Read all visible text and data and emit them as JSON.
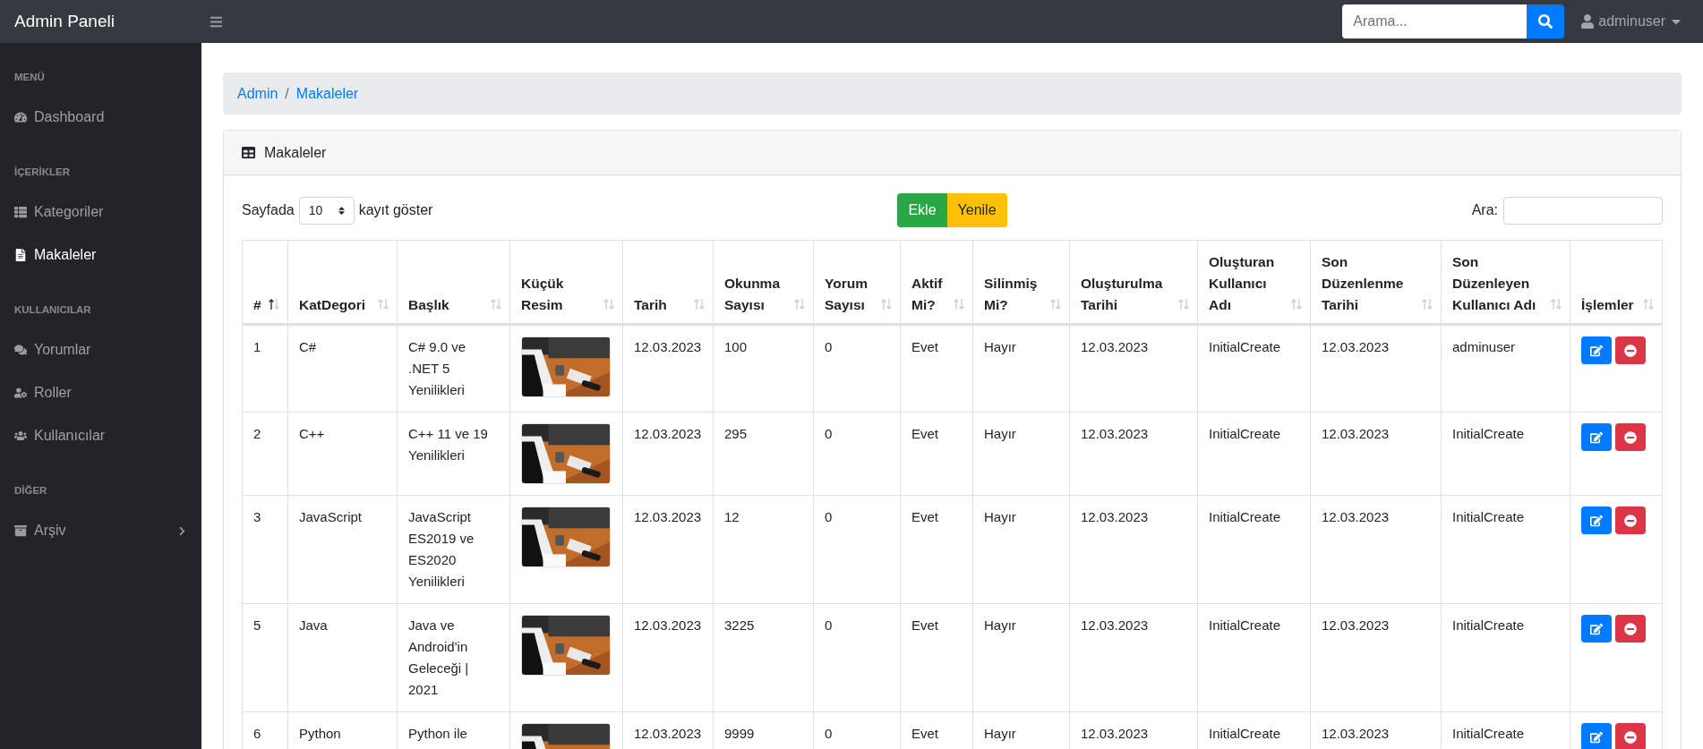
{
  "topbar": {
    "brand": "Admin Paneli",
    "search": {
      "placeholder": "Arama..."
    },
    "user": "adminuser"
  },
  "sidebar": {
    "sections": [
      {
        "heading": "MENÜ",
        "items": [
          {
            "label": "Dashboard",
            "selected": false,
            "kind": "link"
          }
        ]
      },
      {
        "heading": "İÇERİKLER",
        "items": [
          {
            "label": "Kategoriler",
            "selected": false,
            "kind": "link"
          },
          {
            "label": "Makaleler",
            "selected": true,
            "kind": "link"
          }
        ]
      },
      {
        "heading": "KULLANICILAR",
        "items": [
          {
            "label": "Yorumlar",
            "selected": false,
            "kind": "link"
          },
          {
            "label": "Roller",
            "selected": false,
            "kind": "link"
          },
          {
            "label": "Kullanıcılar",
            "selected": false,
            "kind": "link"
          }
        ]
      },
      {
        "heading": "DİĞER",
        "items": [
          {
            "label": "Arşiv",
            "selected": false,
            "kind": "submenu"
          }
        ]
      }
    ]
  },
  "breadcrumb": {
    "items": [
      "Admin",
      "Makaleler"
    ],
    "separator": "/"
  },
  "card": {
    "title": "Makaleler",
    "length": {
      "before": "Sayfada",
      "value": "10",
      "after": "kayıt göster"
    },
    "buttons": [
      {
        "label": "Ekle",
        "kind": "add"
      },
      {
        "label": "Yenile",
        "kind": "refresh"
      }
    ],
    "filter": {
      "label": "Ara:"
    },
    "table": {
      "columns": [
        {
          "label": "#",
          "sorted": true
        },
        {
          "label": "KatDegori",
          "sorted": false
        },
        {
          "label": "Başlık",
          "sorted": false
        },
        {
          "label": "Küçük Resim",
          "sorted": false
        },
        {
          "label": "Tarih",
          "sorted": false
        },
        {
          "label": "Okunma Sayısı",
          "sorted": false
        },
        {
          "label": "Yorum Sayısı",
          "sorted": false
        },
        {
          "label": "Aktif Mi?",
          "sorted": false
        },
        {
          "label": "Silinmiş Mi?",
          "sorted": false
        },
        {
          "label": "Oluşturulma Tarihi",
          "sorted": false
        },
        {
          "label": "Oluşturan Kullanıcı Adı",
          "sorted": false
        },
        {
          "label": "Son Düzenlenme Tarihi",
          "sorted": false
        },
        {
          "label": "Son Düzenleyen Kullanıcı Adı",
          "sorted": false
        },
        {
          "label": "İşlemler",
          "sorted": false
        }
      ],
      "rows": [
        {
          "cells": [
            "1",
            "C#",
            "C# 9.0 ve .NET 5 Yenilikleri",
            {
              "kind": "picture"
            },
            "12.03.2023",
            "100",
            "0",
            "Evet",
            "Hayır",
            "12.03.2023",
            "InitialCreate",
            "12.03.2023",
            "adminuser",
            {
              "kind": "actions"
            }
          ]
        },
        {
          "cells": [
            "2",
            "C++",
            "C++ 11 ve 19 Yenilikleri",
            {
              "kind": "picture"
            },
            "12.03.2023",
            "295",
            "0",
            "Evet",
            "Hayır",
            "12.03.2023",
            "InitialCreate",
            "12.03.2023",
            "InitialCreate",
            {
              "kind": "actions"
            }
          ]
        },
        {
          "cells": [
            "3",
            "JavaScript",
            "JavaScript ES2019 ve ES2020 Yenilikleri",
            {
              "kind": "picture"
            },
            "12.03.2023",
            "12",
            "0",
            "Evet",
            "Hayır",
            "12.03.2023",
            "InitialCreate",
            "12.03.2023",
            "InitialCreate",
            {
              "kind": "actions"
            }
          ]
        },
        {
          "cells": [
            "5",
            "Java",
            "Java ve Android'in Geleceği | 2021",
            {
              "kind": "picture"
            },
            "12.03.2023",
            "3225",
            "0",
            "Evet",
            "Hayır",
            "12.03.2023",
            "InitialCreate",
            "12.03.2023",
            "InitialCreate",
            {
              "kind": "actions"
            }
          ]
        },
        {
          "cells": [
            "6",
            "Python",
            "Python ile",
            {
              "kind": "picture"
            },
            "12.03.2023",
            "9999",
            "0",
            "Evet",
            "Hayır",
            "12.03.2023",
            "InitialCreate",
            "12.03.2023",
            "InitialCreate",
            {
              "kind": "actions"
            }
          ]
        }
      ]
    }
  }
}
